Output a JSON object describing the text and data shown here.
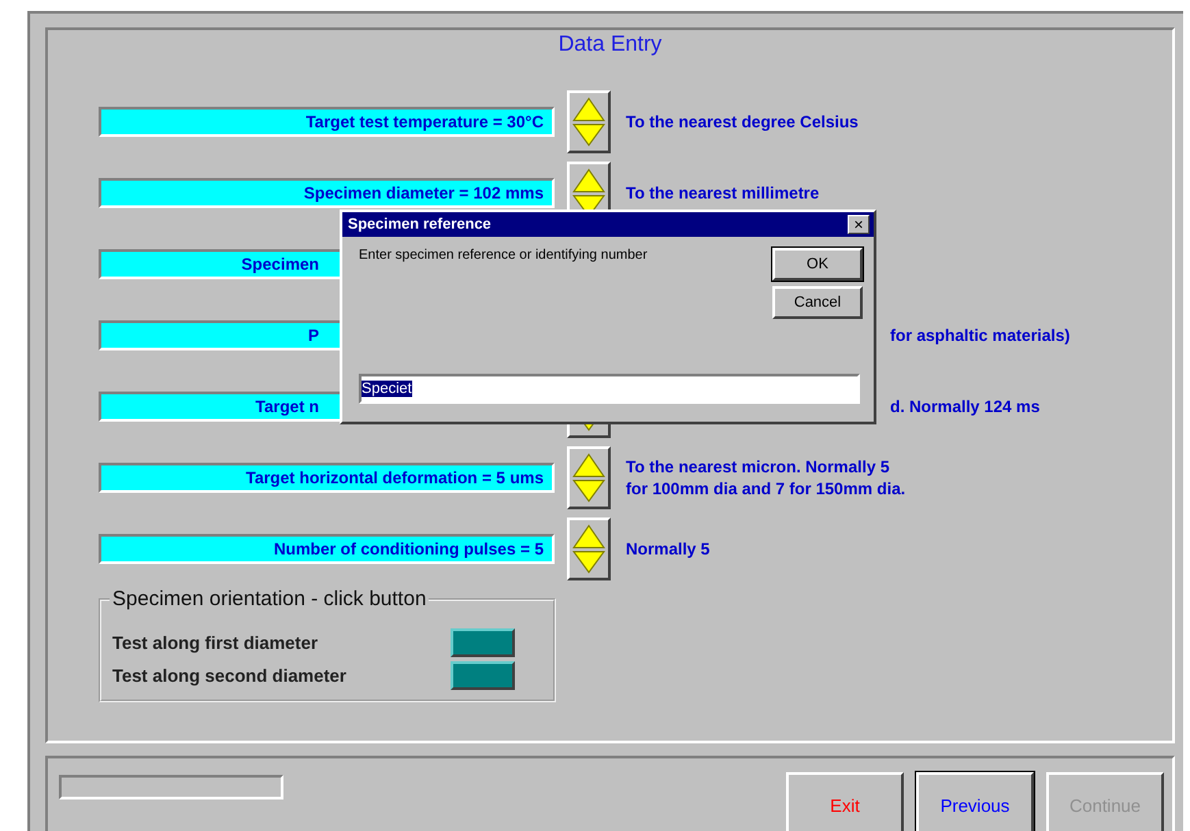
{
  "title": "Data Entry",
  "rows": [
    {
      "kind": "full",
      "field": "Target test temperature = 30°C",
      "note": [
        "To the nearest degree Celsius"
      ]
    },
    {
      "kind": "full",
      "field": "Specimen diameter = 102 mms",
      "note": [
        "To the nearest millimetre"
      ]
    },
    {
      "kind": "covered",
      "field": "Specimen",
      "note": []
    },
    {
      "kind": "covered",
      "field": "P",
      "note": [
        "for asphaltic materials)"
      ]
    },
    {
      "kind": "partial",
      "field": "Target n",
      "note": [
        "d. Normally 124 ms"
      ]
    },
    {
      "kind": "full",
      "field": "Target horizontal deformation = 5 ums",
      "note": [
        "To the nearest micron. Normally 5",
        "for 100mm dia and 7 for 150mm dia."
      ]
    },
    {
      "kind": "full",
      "field": "Number of conditioning pulses = 5",
      "note": [
        "Normally 5"
      ]
    }
  ],
  "orientation": {
    "legend": "Specimen orientation - click button",
    "options": [
      "Test along first diameter",
      "Test along second diameter"
    ]
  },
  "dialog": {
    "title": "Specimen reference",
    "close": "×",
    "message": "Enter specimen reference or identifying number",
    "ok": "OK",
    "cancel": "Cancel",
    "value": "Speciet"
  },
  "buttons": [
    {
      "label": "Exit",
      "kind": "exit",
      "disabled": false
    },
    {
      "label": "Previous",
      "kind": "default",
      "disabled": false
    },
    {
      "label": "Continue",
      "kind": "normal",
      "disabled": true
    }
  ]
}
